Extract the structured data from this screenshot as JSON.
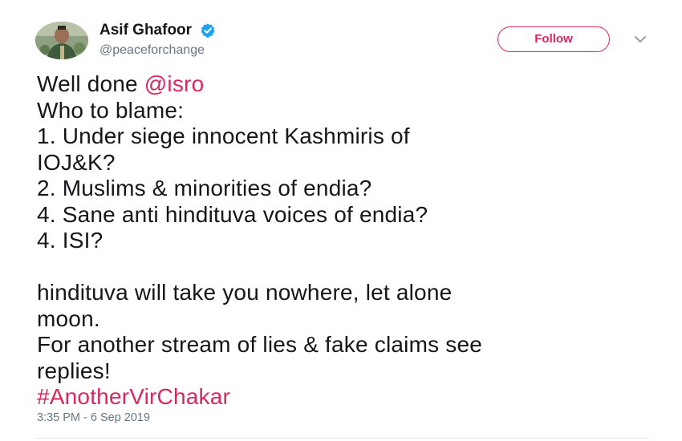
{
  "account": {
    "name": "Asif Ghafoor",
    "handle": "@peaceforchange",
    "verified_icon": "verified-badge-icon"
  },
  "follow_button": {
    "label": "Follow"
  },
  "tweet": {
    "lines": [
      {
        "text": "Well done ",
        "mention": "@isro"
      },
      {
        "text": "Who to blame:"
      },
      {
        "text": "1. Under siege innocent Kashmiris of"
      },
      {
        "text": "IOJ&K?"
      },
      {
        "text": "2. Muslims & minorities of endia?"
      },
      {
        "text": "4. Sane anti hindituva voices of endia?"
      },
      {
        "text": "4. ISI?"
      },
      {
        "text": ""
      },
      {
        "text": "hindituva will take you nowhere, let alone"
      },
      {
        "text": "moon."
      },
      {
        "text": "For another stream of lies & fake claims see"
      },
      {
        "text": "replies!"
      }
    ],
    "hashtag": "#AnotherVirChakar"
  },
  "timestamp": "3:35 PM - 6 Sep 2019",
  "colors": {
    "link": "#e0245e",
    "verified": "#1da1f2",
    "secondary_text": "#657786"
  }
}
